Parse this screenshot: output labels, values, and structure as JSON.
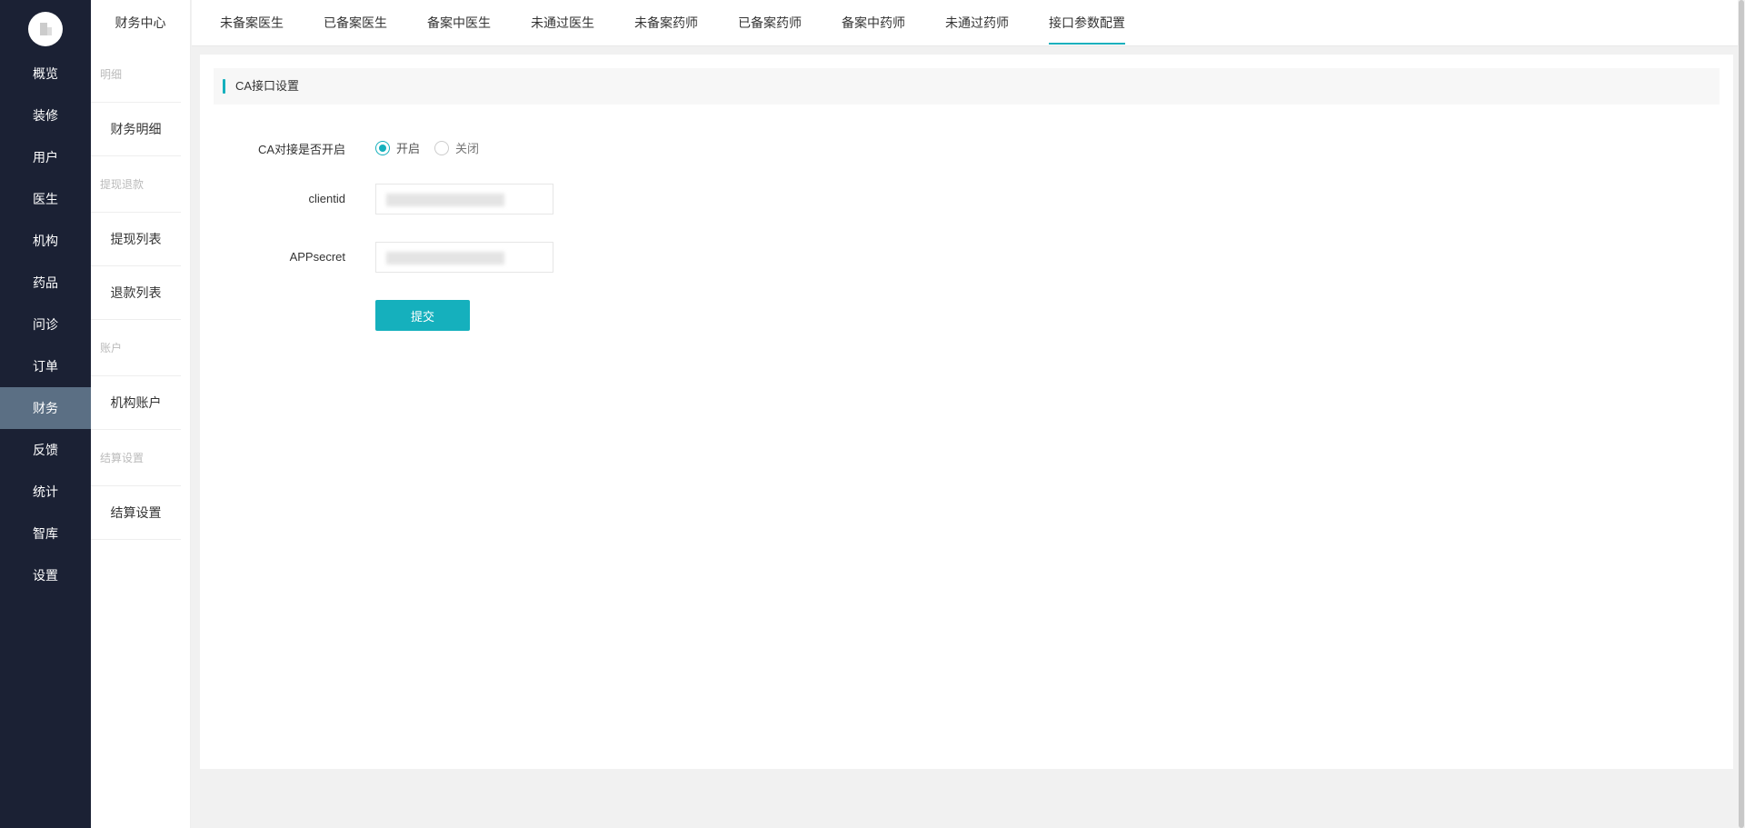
{
  "nav": {
    "items": [
      {
        "label": "概览"
      },
      {
        "label": "装修"
      },
      {
        "label": "用户"
      },
      {
        "label": "医生"
      },
      {
        "label": "机构"
      },
      {
        "label": "药品"
      },
      {
        "label": "问诊"
      },
      {
        "label": "订单"
      },
      {
        "label": "财务",
        "active": true
      },
      {
        "label": "反馈"
      },
      {
        "label": "统计"
      },
      {
        "label": "智库"
      },
      {
        "label": "设置"
      }
    ]
  },
  "subnav": {
    "title": "财务中心",
    "group_detail": "明细",
    "item_finance_detail": "财务明细",
    "group_withdraw": "提现退款",
    "item_withdraw_list": "提现列表",
    "item_refund_list": "退款列表",
    "group_account": "账户",
    "item_org_account": "机构账户",
    "group_settle": "结算设置",
    "item_settle_settings": "结算设置"
  },
  "tabs": [
    {
      "label": "未备案医生"
    },
    {
      "label": "已备案医生"
    },
    {
      "label": "备案中医生"
    },
    {
      "label": "未通过医生"
    },
    {
      "label": "未备案药师"
    },
    {
      "label": "已备案药师"
    },
    {
      "label": "备案中药师"
    },
    {
      "label": "未通过药师"
    },
    {
      "label": "接口参数配置",
      "active": true
    }
  ],
  "form": {
    "section_title": "CA接口设置",
    "ca_enable_label": "CA对接是否开启",
    "option_on": "开启",
    "option_off": "关闭",
    "selected": "开启",
    "clientid_label": "clientid",
    "appsecret_label": "APPsecret",
    "submit_label": "提交"
  },
  "colors": {
    "accent": "#15b0bd",
    "nav_bg": "#1b2134",
    "nav_active": "#5b6f84"
  }
}
